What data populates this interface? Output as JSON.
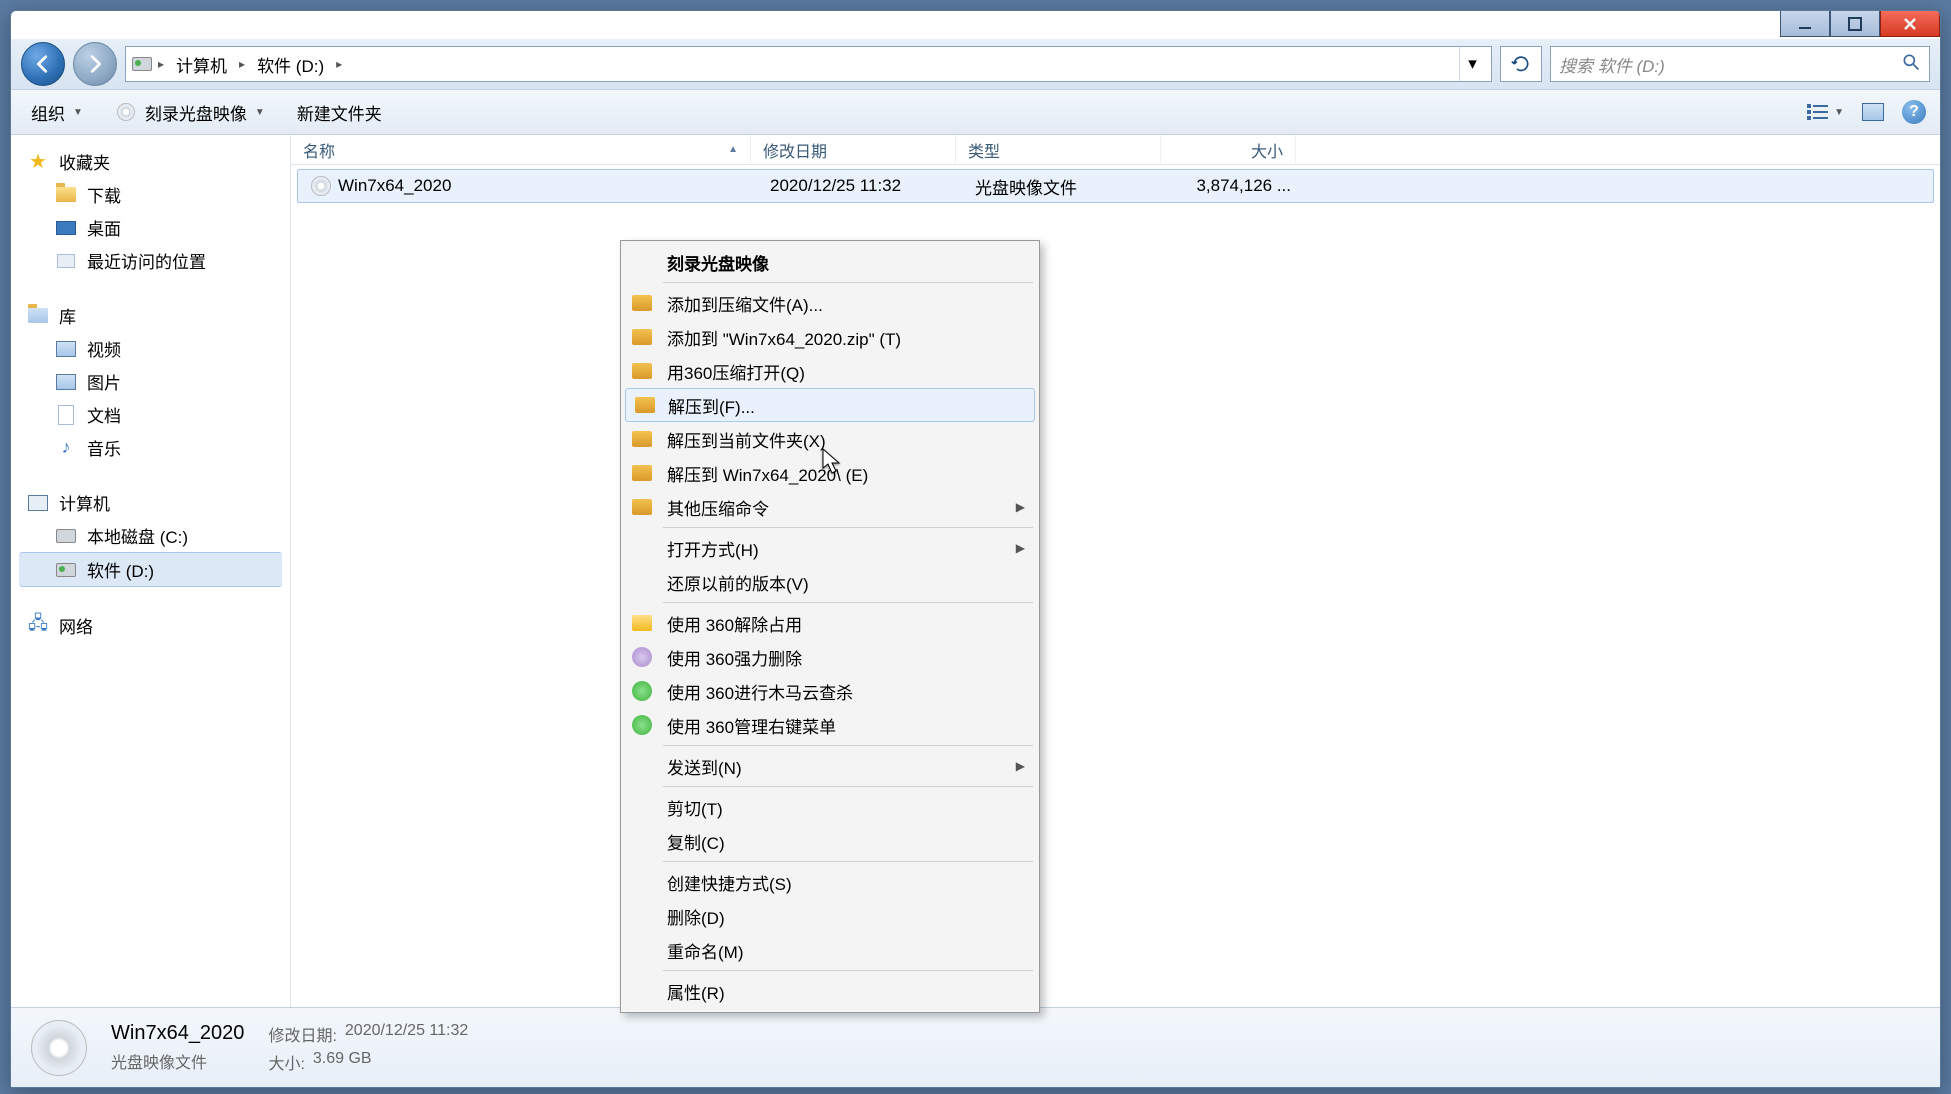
{
  "window": {
    "breadcrumbs": [
      "计算机",
      "软件 (D:)"
    ],
    "search_placeholder": "搜索 软件 (D:)"
  },
  "toolbar": {
    "organize": "组织",
    "burn": "刻录光盘映像",
    "new_folder": "新建文件夹"
  },
  "sidebar": {
    "favorites": {
      "title": "收藏夹",
      "items": [
        "下载",
        "桌面",
        "最近访问的位置"
      ]
    },
    "libraries": {
      "title": "库",
      "items": [
        "视频",
        "图片",
        "文档",
        "音乐"
      ]
    },
    "computer": {
      "title": "计算机",
      "items": [
        "本地磁盘 (C:)",
        "软件 (D:)"
      ]
    },
    "network": {
      "title": "网络"
    }
  },
  "columns": {
    "name": "名称",
    "date": "修改日期",
    "type": "类型",
    "size": "大小"
  },
  "files": [
    {
      "name": "Win7x64_2020",
      "date": "2020/12/25 11:32",
      "type": "光盘映像文件",
      "size": "3,874,126 ..."
    }
  ],
  "context_menu": {
    "burn": "刻录光盘映像",
    "add_to_archive": "添加到压缩文件(A)...",
    "add_to_zip": "添加到 \"Win7x64_2020.zip\" (T)",
    "open_360zip": "用360压缩打开(Q)",
    "extract_to": "解压到(F)...",
    "extract_here": "解压到当前文件夹(X)",
    "extract_named": "解压到 Win7x64_2020\\ (E)",
    "other_zip": "其他压缩命令",
    "open_with": "打开方式(H)",
    "restore_prev": "还原以前的版本(V)",
    "unlock_360": "使用 360解除占用",
    "force_del_360": "使用 360强力删除",
    "scan_360": "使用 360进行木马云查杀",
    "menu_360": "使用 360管理右键菜单",
    "send_to": "发送到(N)",
    "cut": "剪切(T)",
    "copy": "复制(C)",
    "shortcut": "创建快捷方式(S)",
    "delete": "删除(D)",
    "rename": "重命名(M)",
    "properties": "属性(R)"
  },
  "details": {
    "name": "Win7x64_2020",
    "type": "光盘映像文件",
    "date_label": "修改日期:",
    "date": "2020/12/25 11:32",
    "size_label": "大小:",
    "size": "3.69 GB"
  }
}
